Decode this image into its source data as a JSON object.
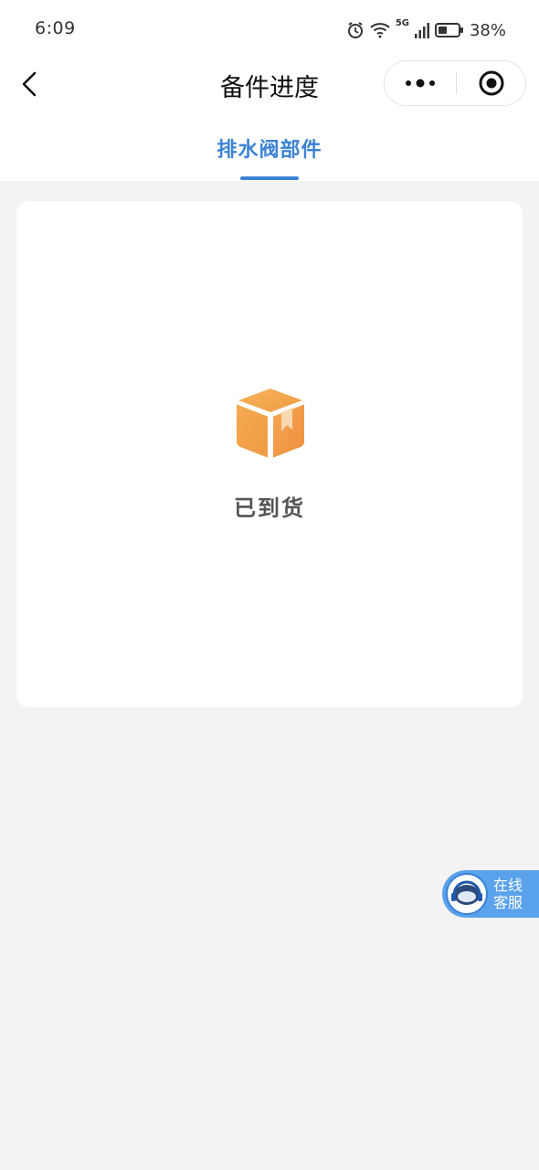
{
  "status_bar": {
    "time": "6:09",
    "network": "5G",
    "battery": "38%"
  },
  "nav": {
    "title": "备件进度",
    "back_icon": "chevron-left-icon",
    "more_icon": "more-dots-icon",
    "close_icon": "target-close-icon"
  },
  "tabs": [
    {
      "label": "排水阀部件",
      "active": true
    }
  ],
  "card": {
    "icon": "package-box-icon",
    "status": "已到货"
  },
  "service": {
    "line1": "在线",
    "line2": "客服"
  },
  "colors": {
    "accent": "#3b82d6",
    "box_orange": "#f0a04a",
    "background": "#f3f3f3"
  }
}
